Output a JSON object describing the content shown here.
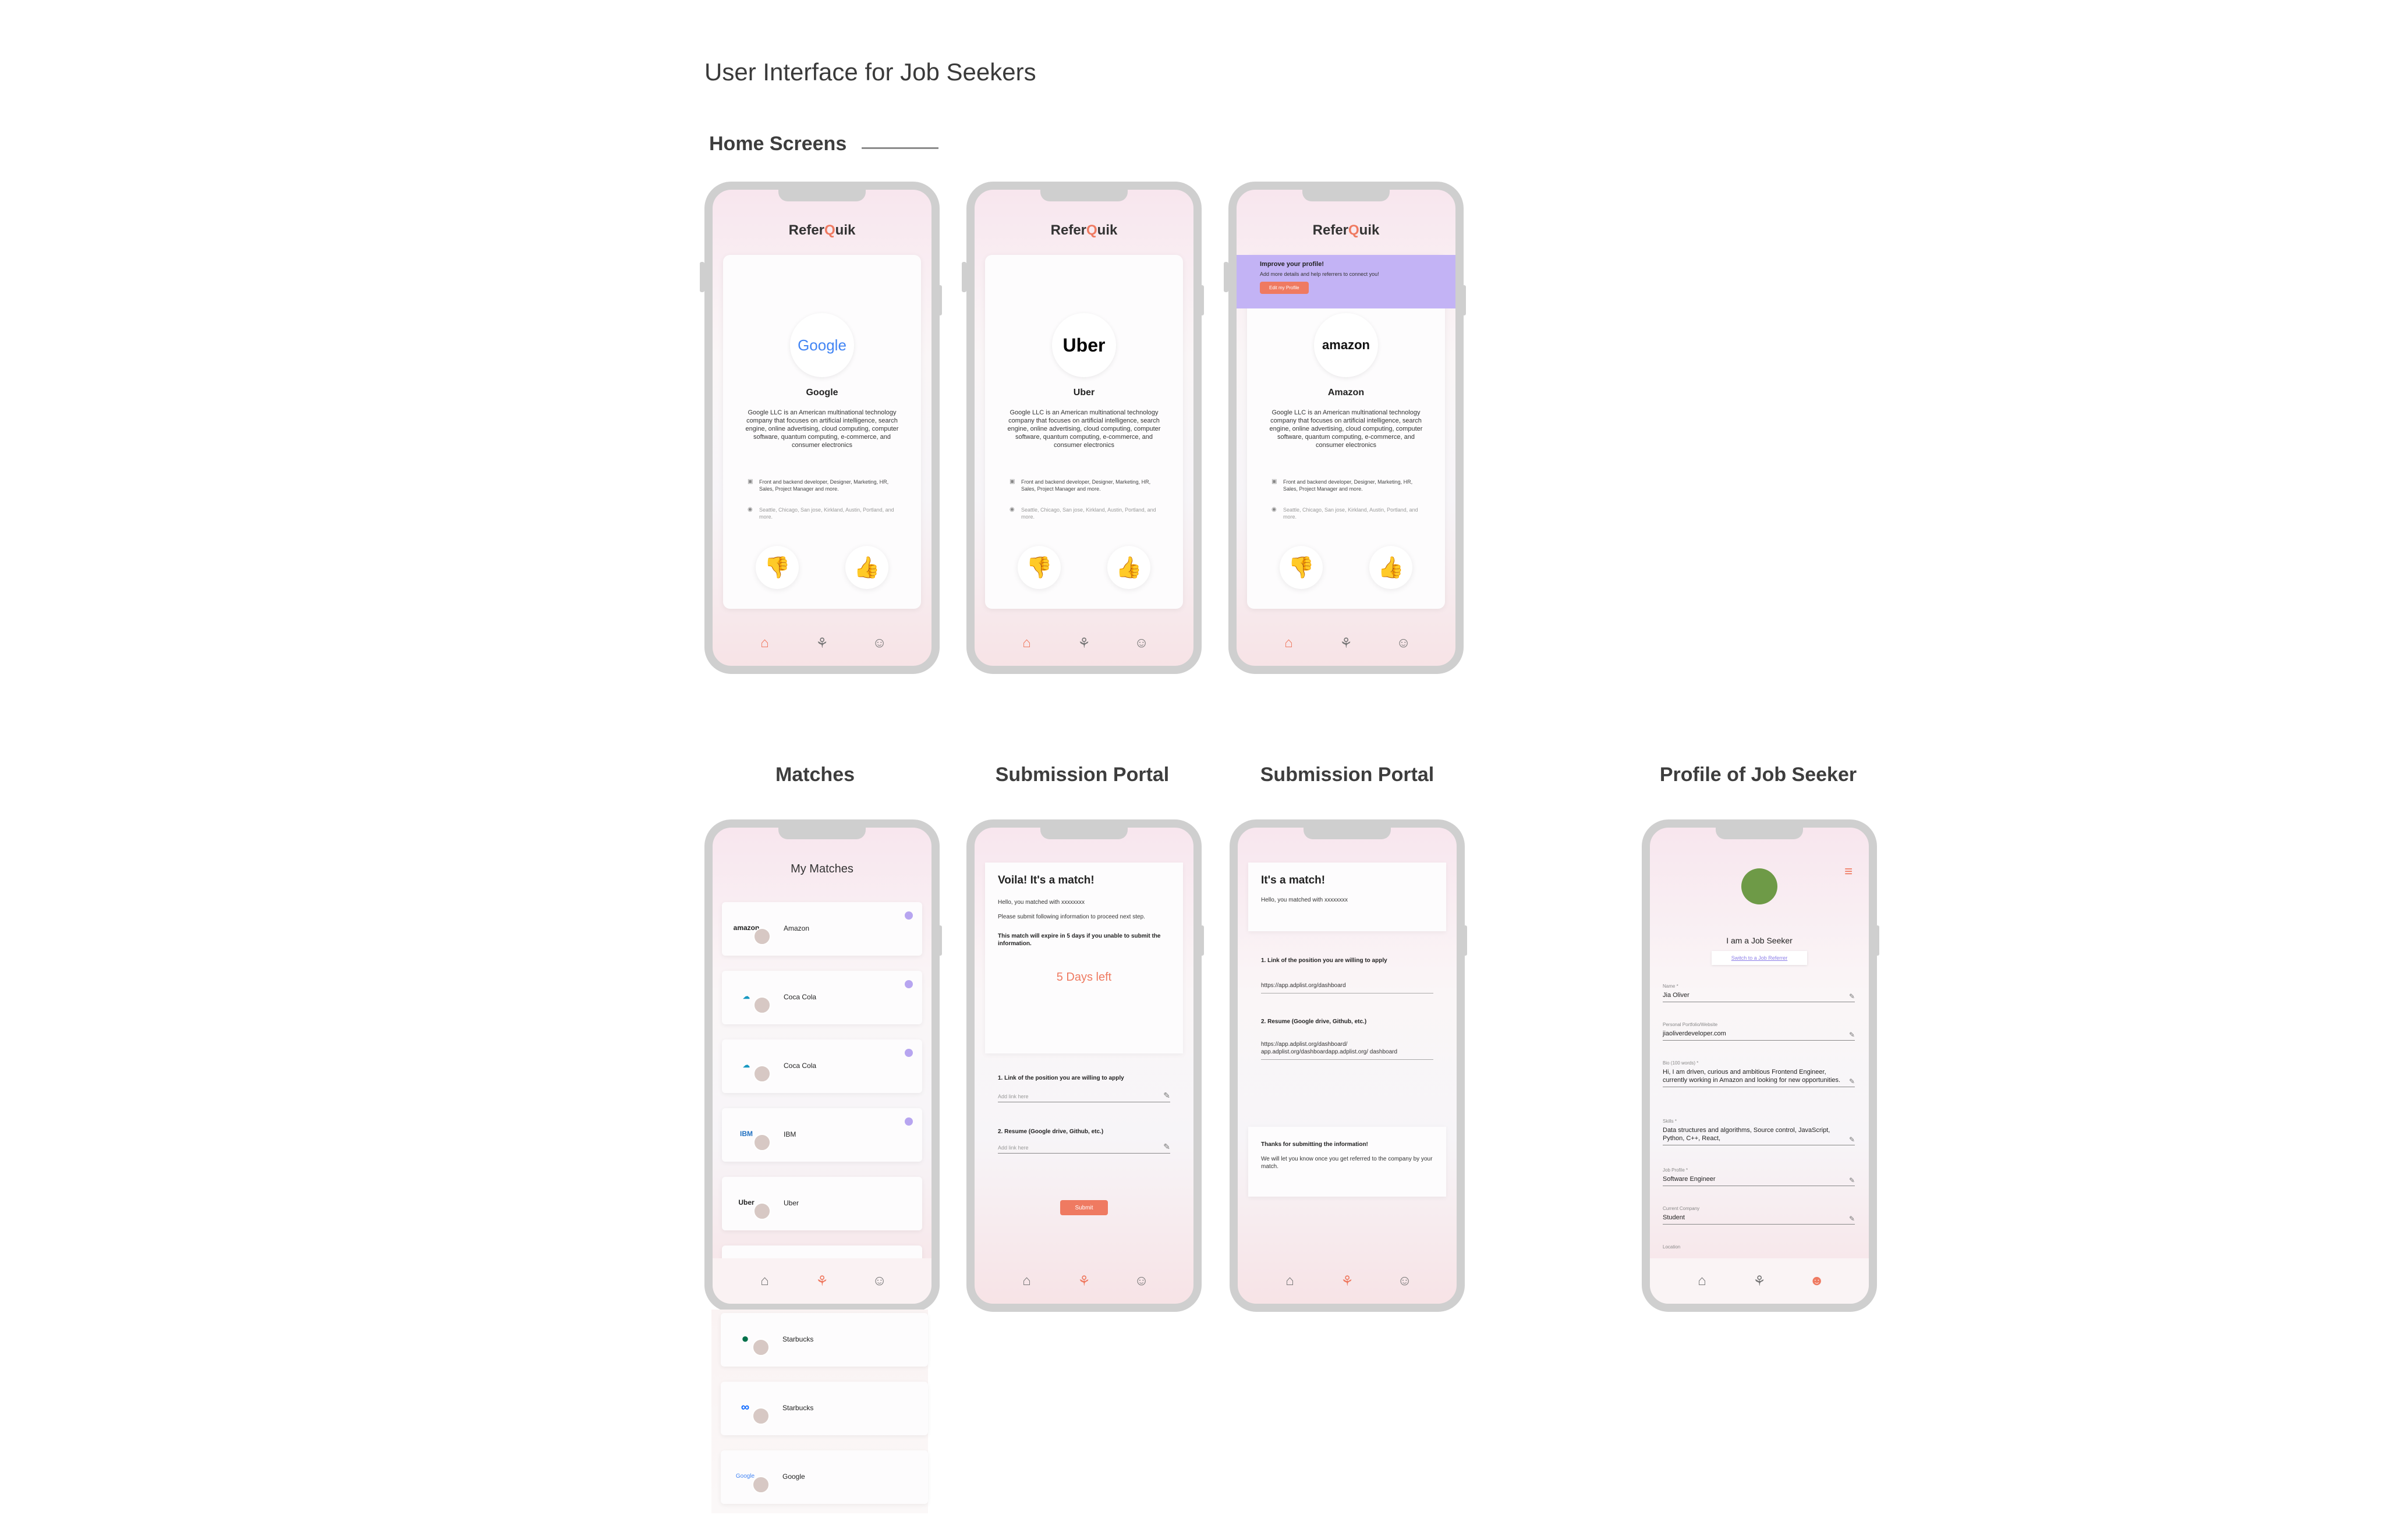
{
  "page_title": "User Interface for Job Seekers",
  "sections": {
    "home": "Home Screens",
    "matches": "Matches",
    "portal1": "Submission Portal",
    "portal2": "Submission Portal",
    "profile": "Profile of Job Seeker"
  },
  "brand": {
    "prefix": "Refer",
    "q": "Q",
    "suffix": "uik"
  },
  "home_cards": [
    {
      "logo": "Google",
      "name": "Google",
      "desc": "Google LLC is an American multinational technology company that focuses on artificial intelligence, search engine, online advertising, cloud computing, computer software, quantum computing, e-commerce, and consumer electronics"
    },
    {
      "logo": "Uber",
      "name": "Uber",
      "desc": "Google LLC is an American multinational technology company that focuses on artificial intelligence, search engine, online advertising, cloud computing, computer software, quantum computing, e-commerce, and consumer electronics"
    },
    {
      "logo": "amazon",
      "name": "Amazon",
      "desc": "Google LLC is an American multinational technology company that focuses on artificial intelligence, search engine, online advertising, cloud computing, computer software, quantum computing, e-commerce, and consumer electronics"
    }
  ],
  "roles_text": "Front and backend developer, Designer, Marketing, HR, Sales, Project Manager and more.",
  "locations_text": "Seattle, Chicago, San jose, Kirkland, Austin, Portland, and more.",
  "banner": {
    "title": "Improve your profile!",
    "text": "Add more details and help referrers to connect you!",
    "button": "Edit my Profile"
  },
  "matches": {
    "title": "My Matches",
    "items": [
      "Amazon",
      "Coca Cola",
      "Coca Cola",
      "IBM",
      "Uber"
    ],
    "overflow": [
      "Starbucks",
      "Starbucks",
      "Google"
    ]
  },
  "portal1": {
    "title": "Voila! It's a match!",
    "greeting": "Hello, you matched with xxxxxxxx",
    "instruction": "Please submit following information to proceed next step.",
    "expiry": "This match will expire in 5 days if you unable to submit the information.",
    "days_left": "5 Days left",
    "q1": "1.  Link of the position you are willing to apply",
    "q1_placeholder": "Add link here",
    "q2": "2.  Resume (Google drive, Github, etc.)",
    "q2_placeholder": "Add link here",
    "submit": "Submit"
  },
  "portal2": {
    "title": "It's a match!",
    "greeting": "Hello, you matched with xxxxxxxx",
    "q1": "1.  Link of the position you are willing to apply",
    "a1": "https://app.adplist.org/dashboard",
    "q2": "2.  Resume (Google drive, Github, etc.)",
    "a2": "https://app.adplist.org/dashboard/ app.adplist.org/dashboardapp.adplist.org/ dashboard",
    "thanks_title": "Thanks for submitting the information!",
    "thanks_text": "We will let you know once you get referred to the company by your match."
  },
  "profile": {
    "role": "I am a Job Seeker",
    "switch": "Switch to a Job Referrer",
    "fields": [
      {
        "label": "Name *",
        "value": "Jia Oliver"
      },
      {
        "label": "Personal Portfolio/Website",
        "value": "jiaoliverdeveloper.com"
      },
      {
        "label": "Bio (100 words) *",
        "value": "Hi, I am driven, curious and ambitious Frontend Engineer, currently working in Amazon and looking for new opportunities."
      },
      {
        "label": "Skills *",
        "value": "Data structures and algorithms, Source control, JavaScript, Python, C++, React,"
      },
      {
        "label": "Job Profile *",
        "value": "Software Engineer"
      },
      {
        "label": "Current Company",
        "value": "Student"
      },
      {
        "label": "Location",
        "value": ""
      }
    ]
  },
  "colors": {
    "accent": "#ef7a61",
    "banner": "#c3b3f5",
    "frame": "#cfcfcf"
  }
}
